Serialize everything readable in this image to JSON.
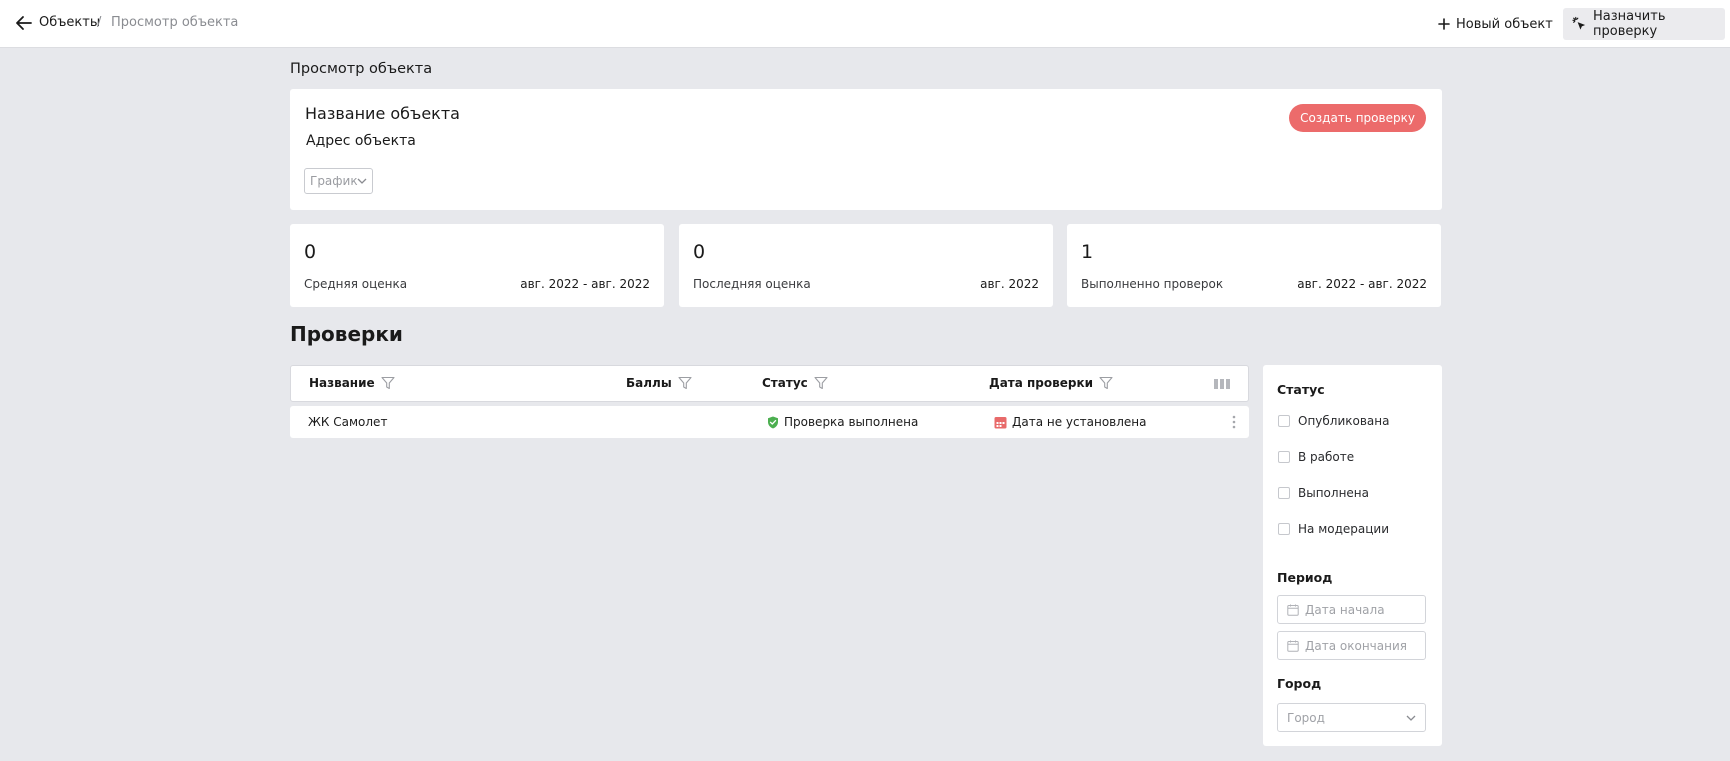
{
  "header": {
    "breadcrumb_link": "Объекты",
    "breadcrumb_sep": "/",
    "breadcrumb_current": "Просмотр объекта",
    "new_object_label": "Новый объект",
    "assign_check_label": "Назначить проверку"
  },
  "page": {
    "title": "Просмотр объекта"
  },
  "object": {
    "name": "Название объекта",
    "address": "Адрес объекта",
    "view_select": "График",
    "create_button": "Создать проверку"
  },
  "stats": [
    {
      "value": "0",
      "label": "Средняя оценка",
      "period": "авг. 2022 - авг. 2022"
    },
    {
      "value": "0",
      "label": "Последняя оценка",
      "period": "авг. 2022"
    },
    {
      "value": "1",
      "label": "Выполненно проверок",
      "period": "авг. 2022 - авг. 2022"
    }
  ],
  "checks": {
    "title": "Проверки",
    "columns": [
      "Название",
      "Баллы",
      "Статус",
      "Дата проверки"
    ],
    "rows": [
      {
        "name": "ЖК Самолет",
        "score": "",
        "status": "Проверка выполнена",
        "date": "Дата не установлена"
      }
    ]
  },
  "filters": {
    "status_title": "Статус",
    "statuses": [
      "Опубликована",
      "В работе",
      "Выполнена",
      "На модерации"
    ],
    "period_title": "Период",
    "start_placeholder": "Дата начала",
    "end_placeholder": "Дата окончания",
    "city_title": "Город",
    "city_placeholder": "Город"
  },
  "colors": {
    "accent": "#ec6b6b",
    "status_ok": "#4caf50",
    "date_warn": "#e86a6a"
  }
}
